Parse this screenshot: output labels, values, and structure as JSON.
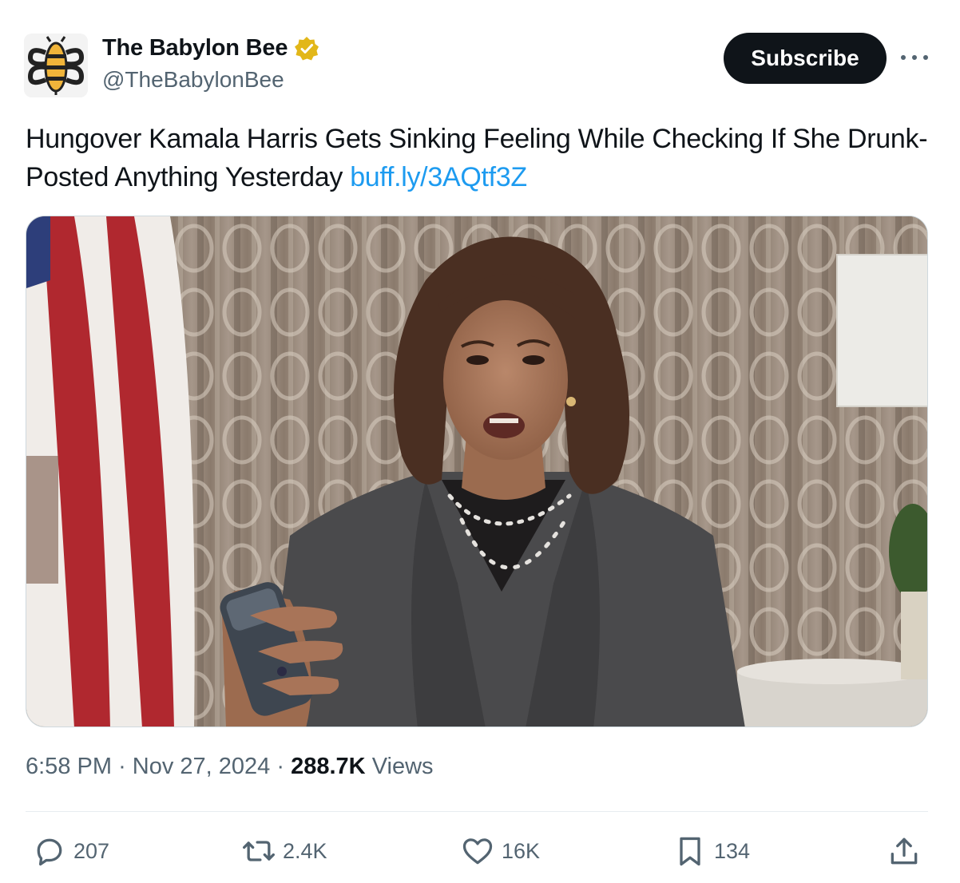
{
  "author": {
    "display_name": "The Babylon Bee",
    "handle": "@TheBabylonBee",
    "verified_color": "#e2b719"
  },
  "header": {
    "subscribe_label": "Subscribe"
  },
  "tweet": {
    "text": "Hungover Kamala Harris Gets Sinking Feeling While Checking If She Drunk-Posted Anything Yesterday ",
    "link": "buff.ly/3AQtf3Z"
  },
  "meta": {
    "time": "6:58 PM",
    "separator": "·",
    "date": "Nov 27, 2024",
    "views_count": "288.7K",
    "views_label": "Views"
  },
  "actions": {
    "replies": "207",
    "reposts": "2.4K",
    "likes": "16K",
    "bookmarks": "134"
  },
  "colors": {
    "link": "#1d9bf0",
    "secondary_text": "#536471",
    "primary_text": "#0f1419"
  },
  "icons": [
    "bee-logo-icon",
    "verified-badge-icon",
    "more-icon",
    "reply-icon",
    "repost-icon",
    "like-icon",
    "bookmark-icon",
    "share-icon"
  ]
}
